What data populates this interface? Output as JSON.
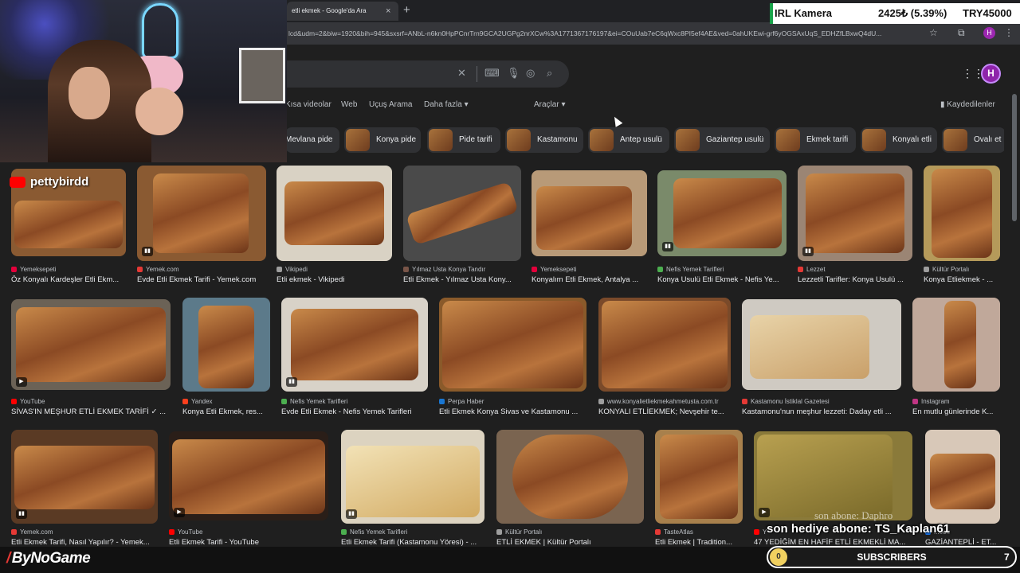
{
  "browser": {
    "tab_title": "etli ekmek - Google'da Ara",
    "tab_close": "×",
    "new_tab": "+",
    "url": "lcd&udm=2&biw=1920&bih=945&sxsrf=ANbL-n6kn0HpPCnrTrn9GCA2UGPg2nrXCw%3A1771367176197&ei=COuUab7eC6qWxc8PI5ef4AE&ved=0ahUKEwi-grf6yOGSAxUqS_EDHZfLBxwQ4dU...",
    "profile_initial": "H"
  },
  "google": {
    "avatar_initial": "H",
    "nav": [
      "Kısa videolar",
      "Web",
      "Uçuş Arama",
      "Daha fazla ▾",
      "Araçlar ▾"
    ],
    "saved_label": "Kaydedilenler",
    "chips": [
      "Mevlana pide",
      "Konya pide",
      "Pide tarifi",
      "Kastamonu",
      "Antep usulü",
      "Gaziantep usulü",
      "Ekmek tarifi",
      "Konyalı etli",
      "Ovalı et"
    ]
  },
  "results": [
    {
      "source": "Yemeksepeti",
      "title": "Öz Konyalı Kardeşler Etli Ekm...",
      "color": "#e4003b",
      "overlay": "pettybirdd"
    },
    {
      "source": "Yemek.com",
      "title": "Evde Etli Ekmek Tarifi - Yemek.com",
      "color": "#e53935"
    },
    {
      "source": "Vikipedi",
      "title": "Etli ekmek - Vikipedi",
      "color": "#9e9e9e"
    },
    {
      "source": "Yılmaz Usta Konya Tandır",
      "title": "Etli Ekmek - Yılmaz Usta Kony...",
      "color": "#795548"
    },
    {
      "source": "Yemeksepeti",
      "title": "Konyalım Etli Ekmek, Antalya ...",
      "color": "#e4003b"
    },
    {
      "source": "Nefis Yemek Tarifleri",
      "title": "Konya Usulü Etli Ekmek - Nefis Ye...",
      "color": "#4caf50"
    },
    {
      "source": "Lezzet",
      "title": "Lezzetli Tarifler: Konya Usulü ...",
      "color": "#e53935"
    },
    {
      "source": "Kültür Portalı",
      "title": "Konya Etliekmek - ...",
      "color": "#9e9e9e"
    },
    {
      "source": "YouTube",
      "title": "SİVAS'IN MEŞHUR ETLİ EKMEK TARİFİ ✓ ...",
      "color": "#ff0000"
    },
    {
      "source": "Yandex",
      "title": "Konya Etli Ekmek, res...",
      "color": "#fc3f1d"
    },
    {
      "source": "Nefis Yemek Tarifleri",
      "title": "Evde Etli Ekmek - Nefis Yemek Tarifleri",
      "color": "#4caf50"
    },
    {
      "source": "Perpa Haber",
      "title": "Etli Ekmek Konya Sivas ve Kastamonu ...",
      "color": "#1976d2"
    },
    {
      "source": "www.konyalietliekmekahmetusta.com.tr",
      "title": "KONYALI ETLİEKMEK; Nevşehir te...",
      "color": "#9e9e9e"
    },
    {
      "source": "Kastamonu İstiklal Gazetesi",
      "title": "Kastamonu'nun meşhur lezzeti: Daday etli ...",
      "color": "#e53935"
    },
    {
      "source": "Instagram",
      "title": "En mutlu günlerinde K...",
      "color": "#c13584"
    },
    {
      "source": "Yemek.com",
      "title": "Etli Ekmek Tarifi, Nasıl Yapılır? - Yemek...",
      "color": "#e53935"
    },
    {
      "source": "YouTube",
      "title": "Etli Ekmek Tarifi - YouTube",
      "color": "#ff0000"
    },
    {
      "source": "Nefis Yemek Tarifleri",
      "title": "Etli Ekmek Tarifi (Kastamonu Yöresi) - ...",
      "color": "#4caf50"
    },
    {
      "source": "Kültür Portalı",
      "title": "ETLİ EKMEK | Kültür Portalı",
      "color": "#9e9e9e"
    },
    {
      "source": "TasteAtlas",
      "title": "Etli Ekmek | Tradition...",
      "color": "#e53935"
    },
    {
      "source": "Y",
      "title": "47 YEDİĞİM EN HAFİF ETLİ EKMEKLİ MA...",
      "color": "#ff0000"
    },
    {
      "source": "...ook",
      "title": "GAZİANTEPLİ - ET...",
      "color": "#1877f2"
    }
  ],
  "overlay": {
    "ticker_label": "IRL Kamera",
    "ticker_value": "2425₺ (5.39%)",
    "ticker_goal": "TRY45000",
    "abone_text": "son hediye abone: TS_Kaplan61",
    "watermark": "son abone: Daphro",
    "logo": "ByNoGame",
    "subs_label": "SUBSCRIBERS",
    "subs_start": "0",
    "subs_goal": "7",
    "yt_overlay": "pettybirdd"
  }
}
